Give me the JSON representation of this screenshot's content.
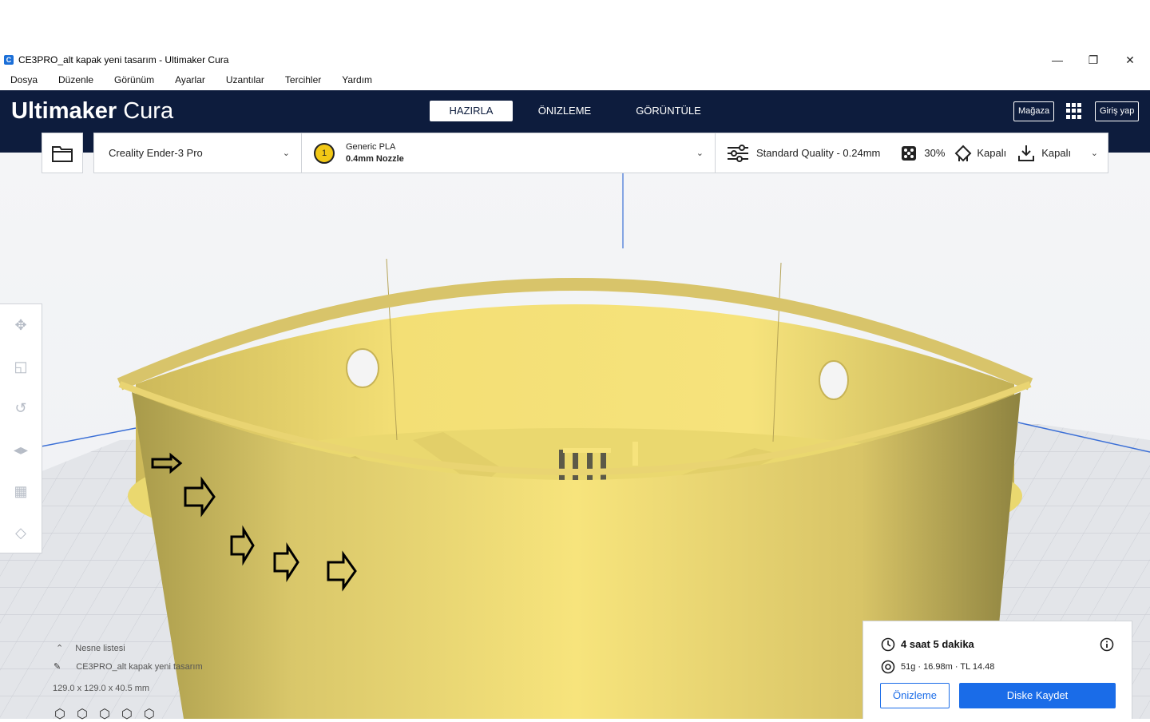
{
  "window": {
    "title": "CE3PRO_alt kapak yeni tasarım - Ultimaker Cura",
    "app_icon": "C"
  },
  "menu": [
    "Dosya",
    "Düzenle",
    "Görünüm",
    "Ayarlar",
    "Uzantılar",
    "Tercihler",
    "Yardım"
  ],
  "header": {
    "logo_bold": "Ultimaker",
    "logo_light": "Cura",
    "tabs": [
      "HAZIRLA",
      "ÖNIZLEME",
      "GÖRÜNTÜLE"
    ],
    "active_tab": "HAZIRLA",
    "marketplace_label": "Mağaza",
    "login_label": "Giriş yap"
  },
  "printer": {
    "name": "Creality Ender-3 Pro"
  },
  "material": {
    "extruder_number": "1",
    "material_name": "Generic PLA",
    "nozzle": "0.4mm Nozzle"
  },
  "print_settings": {
    "profile": "Standard Quality - 0.24mm",
    "infill": "30%",
    "support": "Kapalı",
    "adhesion": "Kapalı"
  },
  "object_list": {
    "title": "Nesne listesi",
    "object_name": "CE3PRO_alt kapak yeni tasarım",
    "dimensions": "129.0 x 129.0 x 40.5 mm"
  },
  "print_summary": {
    "time": "4 saat 5 dakika",
    "material_usage": "51g · 16.98m · TL 14.48",
    "preview_button": "Önizleme",
    "save_button": "Diske Kaydet"
  },
  "colors": {
    "header_bg": "#0d1c3d",
    "accent": "#1a6ce8",
    "model": "#f5e27a"
  }
}
